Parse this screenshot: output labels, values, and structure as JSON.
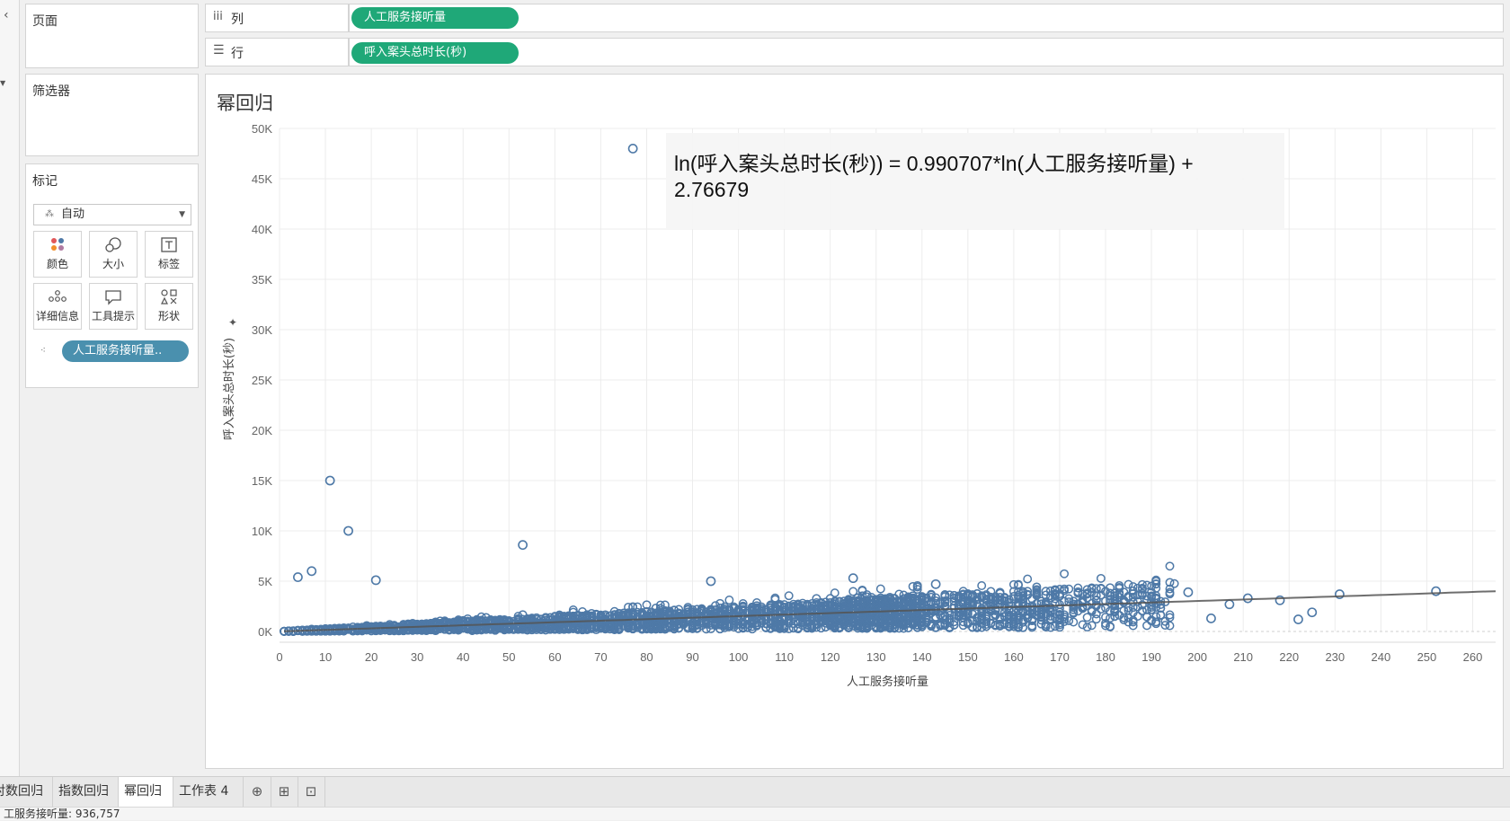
{
  "panes": {
    "pages_title": "页面",
    "filters_title": "筛选器",
    "marks_title": "标记",
    "marks_type": "自动",
    "mark_buttons": [
      "颜色",
      "大小",
      "标签",
      "详细信息",
      "工具提示",
      "形状"
    ],
    "detail_pill": "人工服务接听量.."
  },
  "shelves": {
    "columns_label": "列",
    "columns_pill": "人工服务接听量",
    "rows_label": "行",
    "rows_pill": "呼入案头总时长(秒)"
  },
  "view": {
    "title": "幂回归",
    "equation_line1": "ln(呼入案头总时长(秒)) = 0.990707*ln(人工服务接听量) +",
    "equation_line2": "2.76679"
  },
  "chart_data": {
    "type": "scatter",
    "xlabel": "人工服务接听量",
    "ylabel": "呼入案头总时长(秒)",
    "xlim": [
      0,
      265
    ],
    "ylim": [
      0,
      50000
    ],
    "x_ticks": [
      "0",
      "10",
      "20",
      "30",
      "40",
      "50",
      "60",
      "70",
      "80",
      "90",
      "100",
      "110",
      "120",
      "130",
      "140",
      "150",
      "160",
      "170",
      "180",
      "190",
      "200",
      "210",
      "220",
      "230",
      "240",
      "250",
      "260"
    ],
    "y_ticks": [
      "0K",
      "5K",
      "10K",
      "15K",
      "20K",
      "25K",
      "30K",
      "35K",
      "40K",
      "45K",
      "50K"
    ],
    "grid": true,
    "marker": "open-circle",
    "point_color": "#4e79a7",
    "trend_line": {
      "model": "power",
      "a": 15.909,
      "b": 0.990707,
      "x_range": [
        1,
        265
      ]
    },
    "outliers": [
      {
        "x": 77,
        "y": 48000
      },
      {
        "x": 11,
        "y": 15000
      },
      {
        "x": 15,
        "y": 10000
      },
      {
        "x": 53,
        "y": 8600
      },
      {
        "x": 4,
        "y": 5400
      },
      {
        "x": 7,
        "y": 6000
      },
      {
        "x": 21,
        "y": 5100
      },
      {
        "x": 94,
        "y": 5000
      },
      {
        "x": 125,
        "y": 5300
      },
      {
        "x": 143,
        "y": 4700
      },
      {
        "x": 198,
        "y": 3900
      },
      {
        "x": 211,
        "y": 3300
      },
      {
        "x": 218,
        "y": 3100
      },
      {
        "x": 231,
        "y": 3700
      },
      {
        "x": 252,
        "y": 4000
      },
      {
        "x": 203,
        "y": 1300
      },
      {
        "x": 222,
        "y": 1200
      },
      {
        "x": 225,
        "y": 1900
      },
      {
        "x": 207,
        "y": 2700
      }
    ]
  },
  "tabs": [
    "对数回归",
    "指数回归",
    "幂回归",
    "工作表 4"
  ],
  "status_text": "工服务接听量: 936,757"
}
